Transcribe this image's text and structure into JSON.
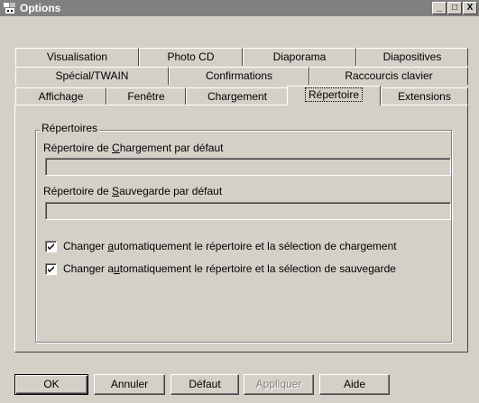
{
  "window": {
    "title": "Options",
    "controls": {
      "minimize": "_",
      "maximize": "□",
      "close": "X"
    }
  },
  "tabs": {
    "row1": [
      "Visualisation",
      "Photo CD",
      "Diaporama",
      "Diapositives"
    ],
    "row2": [
      "Spécial/TWAIN",
      "Confirmations",
      "Raccourcis clavier"
    ],
    "row3": [
      "Affichage",
      "Fenêtre",
      "Chargement",
      "Répertoire",
      "Extensions"
    ],
    "active": "Répertoire"
  },
  "group": {
    "title": "Répertoires",
    "load_label_pre": "Répertoire de ",
    "load_label_key": "C",
    "load_label_post": "hargement par défaut",
    "load_value": "",
    "save_label_pre": "Répertoire de ",
    "save_label_key": "S",
    "save_label_post": "auvegarde par défaut",
    "save_value": "",
    "checkbox_load_pre": "Changer ",
    "checkbox_load_key": "a",
    "checkbox_load_post": "utomatiquement le répertoire et la sélection de chargement",
    "checkbox_load_checked": true,
    "checkbox_save_pre": "Changer a",
    "checkbox_save_key": "u",
    "checkbox_save_post": "tomatiquement le répertoire et la sélection de sauvegarde",
    "checkbox_save_checked": true
  },
  "buttons": {
    "ok": "OK",
    "cancel": "Annuler",
    "default": "Défaut",
    "apply": "Appliquer",
    "help": "Aide"
  }
}
